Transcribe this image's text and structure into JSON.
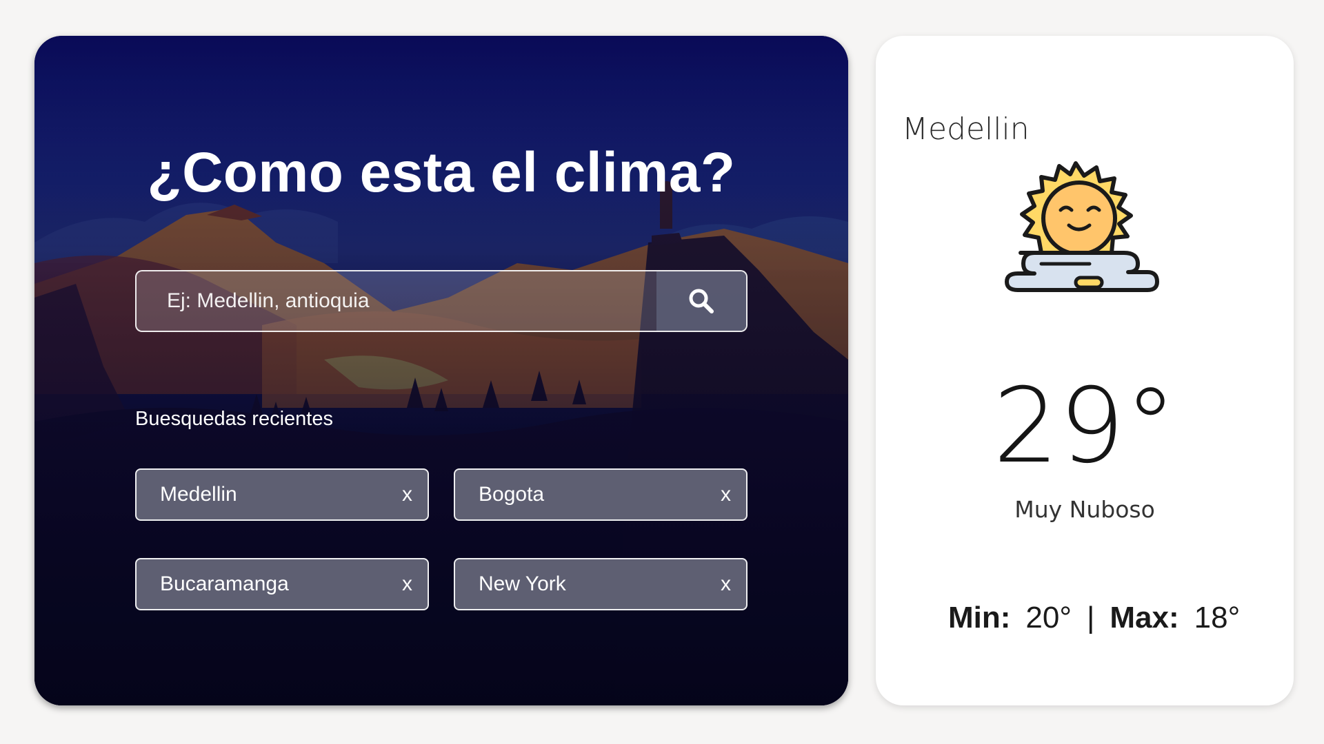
{
  "search_panel": {
    "title": "¿Como esta el clima?",
    "search": {
      "placeholder": "Ej: Medellin, antioquia",
      "button_icon": "search-icon"
    },
    "recent": {
      "title": "Buesquedas recientes",
      "close_label": "x",
      "items": [
        {
          "label": "Medellin"
        },
        {
          "label": "Bogota"
        },
        {
          "label": "Bucaramanga"
        },
        {
          "label": "New York"
        }
      ]
    }
  },
  "weather_card": {
    "city": "Medellin",
    "icon": "sun-behind-cloud-icon",
    "temperature": "29°",
    "condition": "Muy Nuboso",
    "min_label": "Min:",
    "min_value": "20°",
    "separator": "|",
    "max_label": "Max:",
    "max_value": "18°"
  },
  "colors": {
    "page_background": "#f6f5f4",
    "panel_sky_top": "#0b0c5a",
    "panel_bottom": "#05051a",
    "chip_background": "#5e5f72",
    "card_background": "#ffffff"
  }
}
